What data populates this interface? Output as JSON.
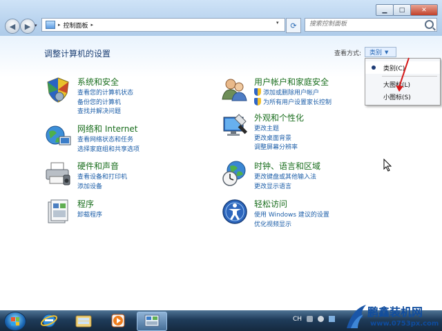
{
  "window": {
    "minimize_glyph": "▁",
    "maximize_glyph": "□",
    "close_glyph": "✕"
  },
  "nav": {
    "back_glyph": "◀",
    "forward_glyph": "▶",
    "dropdown_glyph": "▾"
  },
  "address": {
    "separator": "▸",
    "crumbs": [
      "控制面板"
    ],
    "dropdown_glyph": "▾",
    "refresh_glyph": "⟳"
  },
  "search": {
    "placeholder": "搜索控制面板"
  },
  "page": {
    "title": "调整计算机的设置",
    "view_by_label": "查看方式:",
    "view_by_value": "类别",
    "view_by_caret": "▼"
  },
  "categories": [
    {
      "title": "系统和安全",
      "icon": "shield-security-icon",
      "links": [
        "查看您的计算机状态",
        "备份您的计算机",
        "查找并解决问题"
      ]
    },
    {
      "title": "网络和 Internet",
      "icon": "network-globe-icon",
      "links": [
        "查看网络状态和任务",
        "选择家庭组和共享选项"
      ]
    },
    {
      "title": "硬件和声音",
      "icon": "printer-icon",
      "links": [
        "查看设备和打印机",
        "添加设备"
      ]
    },
    {
      "title": "程序",
      "icon": "programs-icon",
      "links": [
        "卸载程序"
      ]
    },
    {
      "title": "用户帐户和家庭安全",
      "icon": "users-icon",
      "links": [
        "添加或删除用户帐户",
        "为所有用户设置家长控制"
      ]
    },
    {
      "title": "外观和个性化",
      "icon": "appearance-icon",
      "links": [
        "更改主题",
        "更改桌面背景",
        "调整屏幕分辨率"
      ]
    },
    {
      "title": "时钟、语言和区域",
      "icon": "clock-globe-icon",
      "links": [
        "更改键盘或其他输入法",
        "更改显示语言"
      ]
    },
    {
      "title": "轻松访问",
      "icon": "ease-of-access-icon",
      "links": [
        "使用 Windows 建议的设置",
        "优化视频显示"
      ]
    }
  ],
  "view_menu": {
    "items": [
      "类别(C)",
      "大图标(L)",
      "小图标(S)"
    ],
    "selected_index": 0
  },
  "taskbar": {
    "ime_label": "CH",
    "apps": [
      "internet-explorer-icon",
      "windows-explorer-icon",
      "media-player-icon",
      "control-panel-icon"
    ],
    "active_index": 3
  },
  "watermark": {
    "name": "鹏鑫装机网",
    "url": "www.0753px.com"
  },
  "colors": {
    "category_title": "#1a6e1e",
    "link": "#1c5ea8",
    "page_title": "#1c3f74",
    "annotation_arrow": "#d61a1a"
  }
}
